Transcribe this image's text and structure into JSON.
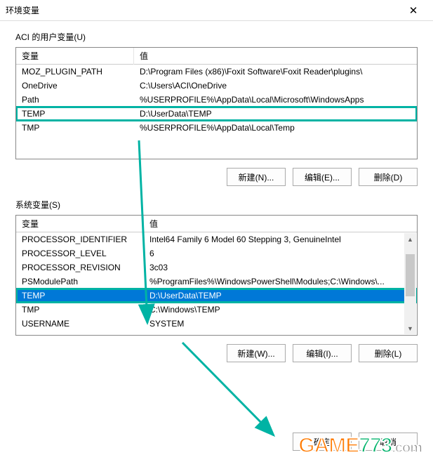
{
  "window": {
    "title": "环境变量",
    "close_glyph": "✕"
  },
  "user_section": {
    "label": "ACI 的用户变量(U)",
    "columns": {
      "name": "变量",
      "value": "值"
    },
    "rows": [
      {
        "name": "MOZ_PLUGIN_PATH",
        "value": "D:\\Program Files (x86)\\Foxit Software\\Foxit Reader\\plugins\\"
      },
      {
        "name": "OneDrive",
        "value": "C:\\Users\\ACI\\OneDrive"
      },
      {
        "name": "Path",
        "value": "%USERPROFILE%\\AppData\\Local\\Microsoft\\WindowsApps"
      },
      {
        "name": "TEMP",
        "value": "D:\\UserData\\TEMP"
      },
      {
        "name": "TMP",
        "value": "%USERPROFILE%\\AppData\\Local\\Temp"
      }
    ],
    "highlight_index": 3,
    "buttons": {
      "new": "新建(N)...",
      "edit": "编辑(E)...",
      "delete": "删除(D)"
    }
  },
  "system_section": {
    "label": "系统变量(S)",
    "columns": {
      "name": "变量",
      "value": "值"
    },
    "rows": [
      {
        "name": "PROCESSOR_IDENTIFIER",
        "value": "Intel64 Family 6 Model 60 Stepping 3, GenuineIntel"
      },
      {
        "name": "PROCESSOR_LEVEL",
        "value": "6"
      },
      {
        "name": "PROCESSOR_REVISION",
        "value": "3c03"
      },
      {
        "name": "PSModulePath",
        "value": "%ProgramFiles%\\WindowsPowerShell\\Modules;C:\\Windows\\..."
      },
      {
        "name": "TEMP",
        "value": "D:\\UserData\\TEMP"
      },
      {
        "name": "TMP",
        "value": "C:\\Windows\\TEMP"
      },
      {
        "name": "USERNAME",
        "value": "SYSTEM"
      }
    ],
    "highlight_index": 4,
    "selected_index": 4,
    "buttons": {
      "new": "新建(W)...",
      "edit": "编辑(I)...",
      "delete": "删除(L)"
    }
  },
  "dialog_buttons": {
    "ok": "确定",
    "cancel": "取消"
  },
  "watermark": {
    "part1": "GAME",
    "part2": "773",
    "part3": ".com"
  },
  "colors": {
    "highlight_border": "#00b3a4",
    "selection_bg": "#0078d7"
  }
}
